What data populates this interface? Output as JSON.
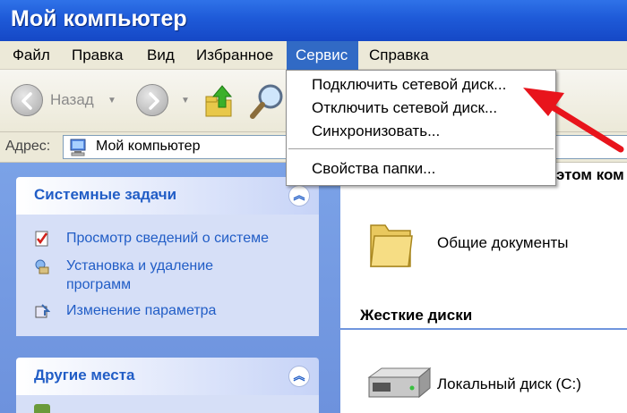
{
  "window": {
    "title": "Мой компьютер"
  },
  "menu": {
    "items": [
      {
        "label": "Файл"
      },
      {
        "label": "Правка"
      },
      {
        "label": "Вид"
      },
      {
        "label": "Избранное"
      },
      {
        "label": "Сервис"
      },
      {
        "label": "Справка"
      }
    ],
    "active": "Сервис"
  },
  "toolbar": {
    "back_label": "Назад"
  },
  "address": {
    "label": "Адрес:",
    "value": "Мой компьютер"
  },
  "dropdown": {
    "items": [
      {
        "label": "Подключить сетевой диск..."
      },
      {
        "label": "Отключить сетевой диск..."
      },
      {
        "label": "Синхронизовать..."
      },
      {
        "label": "Свойства папки..."
      }
    ]
  },
  "system_tasks": {
    "title": "Системные задачи",
    "items": [
      {
        "label": "Просмотр сведений о системе"
      },
      {
        "label": "Установка и удаление\nпрограмм",
        "line1": "Установка и удаление",
        "line2": "программ"
      },
      {
        "label": "Изменение параметра"
      }
    ]
  },
  "other_places": {
    "title": "Другие места"
  },
  "right": {
    "partial_header": "этом ком",
    "folder_item": "Общие документы",
    "hard_disks_header": "Жесткие диски",
    "disk_item": "Локальный диск (C:)"
  },
  "colors": {
    "title_bar": "#1e5ad8",
    "menu_active": "#316ac5",
    "task_link": "#215dc6",
    "arrow": "#e8141c"
  },
  "icons": [
    "back-icon",
    "forward-icon",
    "up-folder-icon",
    "search-icon",
    "computer-icon",
    "system-info-icon",
    "add-remove-icon",
    "settings-icon",
    "folder-icon",
    "hard-disk-icon",
    "collapse-icon"
  ]
}
